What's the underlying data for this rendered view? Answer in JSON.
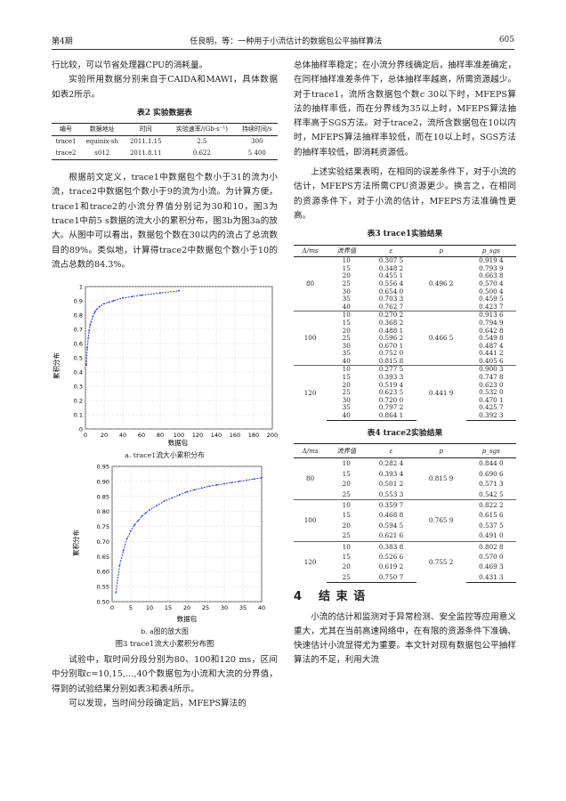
{
  "header": {
    "left": "第4期",
    "center": "任良明，等：一种用于小流估计的数据包公平抽样算法",
    "right": "605"
  },
  "left": {
    "p1": "行比较，可以节省处理器CPU的消耗量。",
    "p2": "实验所用数据分别来自于CAIDA和MAWI，具体数据如表2所示。",
    "t2": {
      "caption": "表2  实验数据表",
      "headers": [
        "编号",
        "数据地址",
        "时间",
        "实验速率/(Gb·s⁻¹)",
        "持续时间/s"
      ],
      "rows": [
        [
          "trace1",
          "equinix-sh",
          "2011.1.15",
          "2.5",
          "300"
        ],
        [
          "trace2",
          "s012",
          "2011.8.11",
          "0.622",
          "5 400"
        ]
      ]
    },
    "p3": "根据前文定义，trace1中数据包个数小于31的流为小流，trace2中数据包个数小于9的流为小流。为计算方便，trace1和trace2的小流分界值分别记为30和10，图3为trace1中前5 s数据的流大小的累积分布，图3b为图3a的放大。从图中可以看出，数据包个数在30以内的流占了总流数目的89%。类似地，计算得trace2中数据包个数小于10的流占总数的84.3%。",
    "fig3a": {
      "ylabel": "累积分布",
      "xlabel": "数据包",
      "caption": "a. trace1流大小累积分布",
      "yticks": [
        "1",
        "0.9",
        "0.8",
        "0.7",
        "0.6",
        "0.5",
        "0.4",
        "0.3",
        "0.2",
        "0.1",
        "0"
      ],
      "xticks": [
        "0",
        "20",
        "40",
        "60",
        "80",
        "100",
        "120",
        "140",
        "160",
        "180",
        "200"
      ]
    },
    "fig3b": {
      "ylabel": "累积分布",
      "xlabel": "数据包",
      "caption": "b. a图的放大图",
      "yticks": [
        "0.95",
        "0.90",
        "0.85",
        "0.80",
        "0.75",
        "0.70",
        "0.65",
        "0.60",
        "0.55",
        "0.50"
      ],
      "xticks": [
        "0",
        "5",
        "10",
        "15",
        "20",
        "25",
        "30",
        "35",
        "40"
      ]
    },
    "fig3_caption": "图3  trace1流大小累积分布图",
    "p4": "试验中，取时间分段分别为80、100和120 ms，区间中分别取c=10,15,…,40个数据包为小流和大流的分界值，得到的试验结果分别如表3和表4所示。",
    "p5": "可以发现，当时间分段确定后，MFEPS算法的"
  },
  "right": {
    "p1": "总体抽样率稳定；在小流分界线确定后，抽样率准差确定，在同样抽样准差条件下，总体抽样率越高，所需资源越少。对于trace1，流所含数据包个数c 30以下时，MFEPS算法的抽样率低，而在分界线为35以上时，MFEPS算法抽样率高于SGS方法。对于trace2，流所含数据包在10以内时，MFEPS算法抽样率较低，而在10以上时，SGS方法的抽样率较低，即消耗资源低。",
    "p2": "上述实验结果表明，在相同的误差条件下，对于小流的估计，MFEPS方法所需CPU资源更少。换言之，在相同的资源条件下，对于小流的估计，MFEPS方法准确性更高。",
    "t3": {
      "caption": "表3  trace1实验结果",
      "headers": [
        "Δ/ms",
        "流界值",
        "ε",
        "p",
        "p_sgs"
      ],
      "groups": [
        {
          "d": "80",
          "p": "0.496 2",
          "rows": [
            [
              "10",
              "0.307 5",
              "0.919 4"
            ],
            [
              "15",
              "0.348 2",
              "0.793 9"
            ],
            [
              "20",
              "0.455 1",
              "0.663 8"
            ],
            [
              "25",
              "0.556 4",
              "0.570 4"
            ],
            [
              "30",
              "0.654 0",
              "0.500 4"
            ],
            [
              "35",
              "0.703 3",
              "0.459 5"
            ],
            [
              "40",
              "0.762 7",
              "0.423 7"
            ]
          ]
        },
        {
          "d": "100",
          "p": "0.466 5",
          "rows": [
            [
              "10",
              "0.270 2",
              "0.913 6"
            ],
            [
              "15",
              "0.368 2",
              "0.794 9"
            ],
            [
              "20",
              "0.488 1",
              "0.642 8"
            ],
            [
              "25",
              "0.596 2",
              "0.549 8"
            ],
            [
              "30",
              "0.670 1",
              "0.487 4"
            ],
            [
              "35",
              "0.752 0",
              "0.441 2"
            ],
            [
              "40",
              "0.815 8",
              "0.405 6"
            ]
          ]
        },
        {
          "d": "120",
          "p": "0.441 9",
          "rows": [
            [
              "10",
              "0.277 5",
              "0.900 3"
            ],
            [
              "15",
              "0.393 3",
              "0.747 8"
            ],
            [
              "20",
              "0.519 4",
              "0.623 0"
            ],
            [
              "25",
              "0.623 5",
              "0.532 0"
            ],
            [
              "30",
              "0.720 0",
              "0.470 1"
            ],
            [
              "35",
              "0.797 2",
              "0.425 7"
            ],
            [
              "40",
              "0.864 1",
              "0.392 3"
            ]
          ]
        }
      ]
    },
    "t4": {
      "caption": "表4  trace2实验结果",
      "headers": [
        "Δ/ms",
        "流界值",
        "ε",
        "p",
        "p_sgs"
      ],
      "groups": [
        {
          "d": "80",
          "p": "0.815 9",
          "rows": [
            [
              "10",
              "0.282 4",
              "0.844 0"
            ],
            [
              "15",
              "0.393 4",
              "0.690 6"
            ],
            [
              "20",
              "0.501 2",
              "0.571 3"
            ],
            [
              "25",
              "0.553 3",
              "0.542 5"
            ]
          ]
        },
        {
          "d": "100",
          "p": "0.765 9",
          "rows": [
            [
              "10",
              "0.359 7",
              "0.822 2"
            ],
            [
              "15",
              "0.468 8",
              "0.615 6"
            ],
            [
              "20",
              "0.594 5",
              "0.537 5"
            ],
            [
              "25",
              "0.621 6",
              "0.491 0"
            ]
          ]
        },
        {
          "d": "120",
          "p": "0.755 2",
          "rows": [
            [
              "10",
              "0.383 8",
              "0.802 8"
            ],
            [
              "15",
              "0.526 6",
              "0.570 0"
            ],
            [
              "20",
              "0.619 2",
              "0.469 3"
            ],
            [
              "25",
              "0.750 7",
              "0.431 3"
            ]
          ]
        }
      ]
    },
    "sec_num": "4",
    "sec_title": "结 束 语",
    "p3": "小流的估计和监测对于异常检测、安全监控等应用意义重大，尤其在当前高速网络中，在有限的资源条件下准确、快速估计小流显得尤为重要。本文针对现有数据包公平抽样算法的不足，利用大流"
  },
  "chart_data": [
    {
      "type": "line",
      "xlabel": "数据包",
      "ylabel": "累积分布",
      "xlim": [
        0,
        200
      ],
      "ylim": [
        0,
        1
      ],
      "x": [
        1,
        2,
        3,
        4,
        5,
        6,
        8,
        10,
        12,
        15,
        20,
        25,
        30,
        40,
        50,
        60,
        80,
        100
      ],
      "values": [
        0.45,
        0.57,
        0.64,
        0.69,
        0.73,
        0.75,
        0.79,
        0.82,
        0.84,
        0.86,
        0.88,
        0.89,
        0.9,
        0.92,
        0.93,
        0.94,
        0.955,
        0.97
      ]
    },
    {
      "type": "line",
      "xlabel": "数据包",
      "ylabel": "累积分布",
      "xlim": [
        0,
        40
      ],
      "ylim": [
        0.5,
        0.95
      ],
      "x": [
        1,
        2,
        3,
        4,
        5,
        6,
        7,
        8,
        9,
        10,
        12,
        14,
        16,
        18,
        20,
        22,
        24,
        26,
        28,
        30,
        32,
        34,
        36,
        38,
        40
      ],
      "values": [
        0.53,
        0.62,
        0.67,
        0.71,
        0.735,
        0.755,
        0.77,
        0.785,
        0.795,
        0.805,
        0.82,
        0.835,
        0.845,
        0.855,
        0.865,
        0.872,
        0.878,
        0.884,
        0.888,
        0.892,
        0.896,
        0.9,
        0.904,
        0.908,
        0.912
      ]
    }
  ]
}
